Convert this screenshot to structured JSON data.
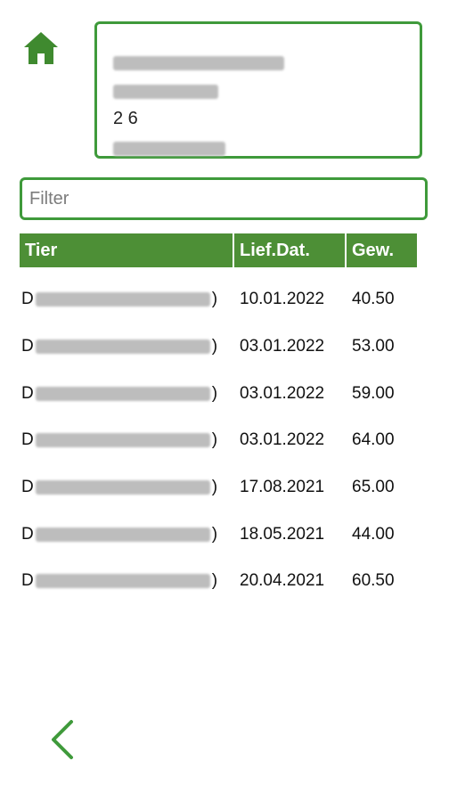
{
  "header": {
    "home_icon": "home-icon",
    "address": {
      "lines": [
        "",
        "",
        "2 6",
        ""
      ],
      "note": "address text is blurred/redacted in the screenshot"
    }
  },
  "filter": {
    "placeholder": "Filter",
    "value": ""
  },
  "table": {
    "columns": [
      "Tier",
      "Lief.Dat.",
      "Gew."
    ],
    "rows": [
      {
        "tier_prefix": "D",
        "tier_suffix": ")",
        "date": "10.01.2022",
        "weight": "40.50"
      },
      {
        "tier_prefix": "D",
        "tier_suffix": ")",
        "date": "03.01.2022",
        "weight": "53.00"
      },
      {
        "tier_prefix": "D",
        "tier_suffix": ")",
        "date": "03.01.2022",
        "weight": "59.00"
      },
      {
        "tier_prefix": "D",
        "tier_suffix": ")",
        "date": "03.01.2022",
        "weight": "64.00"
      },
      {
        "tier_prefix": "D",
        "tier_suffix": ")",
        "date": "17.08.2021",
        "weight": "65.00"
      },
      {
        "tier_prefix": "D",
        "tier_suffix": ")",
        "date": "18.05.2021",
        "weight": "44.00"
      },
      {
        "tier_prefix": "D",
        "tier_suffix": ")",
        "date": "20.04.2021",
        "weight": "60.50"
      }
    ]
  },
  "footer": {
    "back_icon": "chevron-left-icon"
  },
  "colors": {
    "accent": "#3f9a3b",
    "header_bg": "#4d8f36"
  }
}
